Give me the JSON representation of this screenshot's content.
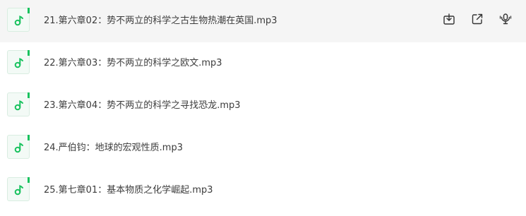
{
  "files": [
    {
      "name": "21.第六章02：势不两立的科学之古生物热潮在英国.mp3",
      "icon": "music-file-icon",
      "hovered": true
    },
    {
      "name": "22.第六章03：势不两立的科学之欧文.mp3",
      "icon": "music-file-icon",
      "hovered": false
    },
    {
      "name": "23.第六章04：势不两立的科学之寻找恐龙.mp3",
      "icon": "music-file-icon",
      "hovered": false
    },
    {
      "name": "24.严伯钧：地球的宏观性质.mp3",
      "icon": "music-file-icon",
      "hovered": false
    },
    {
      "name": "25.第七章01：基本物质之化学崛起.mp3",
      "icon": "music-file-icon",
      "hovered": false
    }
  ],
  "row_actions": [
    "download-icon",
    "share-icon",
    "listen-icon"
  ],
  "colors": {
    "accent": "#18c25e",
    "hover_bg": "#f5f5f5",
    "icon_stroke": "#333333"
  }
}
